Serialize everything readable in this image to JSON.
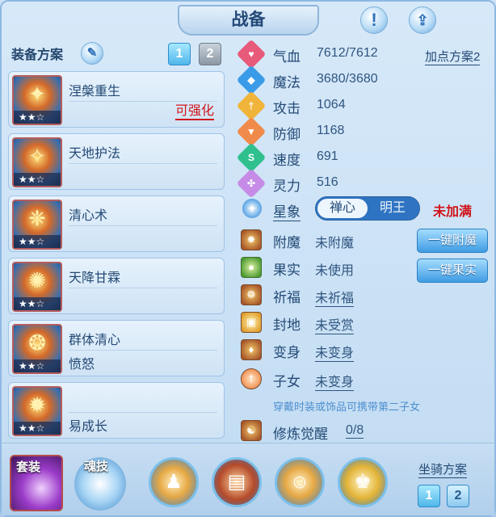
{
  "header": {
    "title": "战备"
  },
  "left": {
    "plan_label": "装备方案",
    "plan_numbers": [
      "1",
      "2"
    ],
    "skills": [
      {
        "name": "涅槃重生",
        "stars": "★★☆",
        "sub": "",
        "action": "可强化"
      },
      {
        "name": "天地护法",
        "stars": "★★☆",
        "sub": "",
        "action": ""
      },
      {
        "name": "清心术",
        "stars": "★★☆",
        "sub": "",
        "action": ""
      },
      {
        "name": "天降甘霖",
        "stars": "★★☆",
        "sub": "",
        "action": ""
      },
      {
        "name": "群体清心",
        "stars": "★★☆",
        "sub": "愤怒",
        "action": ""
      },
      {
        "name": "",
        "stars": "★★☆",
        "sub": "易成长",
        "action": ""
      }
    ]
  },
  "stats": {
    "plan2_label": "加点方案2",
    "items": [
      {
        "label": "气血",
        "value": "7612/7612",
        "icon": "heart-icon",
        "color": "#e85a7a"
      },
      {
        "label": "魔法",
        "value": "3680/3680",
        "icon": "mana-icon",
        "color": "#3a9be8"
      },
      {
        "label": "攻击",
        "value": "1064",
        "icon": "attack-icon",
        "color": "#f0b43a"
      },
      {
        "label": "防御",
        "value": "1168",
        "icon": "defense-icon",
        "color": "#f08a4a"
      },
      {
        "label": "速度",
        "value": "691",
        "icon": "speed-icon",
        "color": "#2fc08e"
      },
      {
        "label": "灵力",
        "value": "516",
        "icon": "spirit-icon",
        "color": "#c58be6"
      }
    ]
  },
  "star_sign": {
    "label": "星象",
    "option_active": "禅心",
    "option_inactive": "明王",
    "status": "未加满"
  },
  "rows": [
    {
      "label": "附魔",
      "value": "未附魔",
      "underline": false,
      "icon": "enchant-icon"
    },
    {
      "label": "果实",
      "value": "未使用",
      "underline": false,
      "icon": "fruit-icon"
    },
    {
      "label": "祈福",
      "value": "未祈福",
      "underline": true,
      "icon": "bless-icon"
    },
    {
      "label": "封地",
      "value": "未受赏",
      "underline": true,
      "icon": "fief-icon"
    },
    {
      "label": "变身",
      "value": "未变身",
      "underline": true,
      "icon": "transform-icon"
    },
    {
      "label": "子女",
      "value": "未变身",
      "underline": true,
      "icon": "child-icon"
    }
  ],
  "buttons": {
    "one_click_enchant": "一键附魔",
    "one_click_fruit": "一键果实"
  },
  "hint": "穿戴时装或饰品可携带第二子女",
  "cultivation": {
    "label": "修炼觉醒",
    "value": "0/8"
  },
  "bottom": {
    "suit_label": "套装",
    "soul_label": "魂技",
    "mount_label": "坐骑方案",
    "mount_numbers": [
      "1",
      "2"
    ]
  }
}
